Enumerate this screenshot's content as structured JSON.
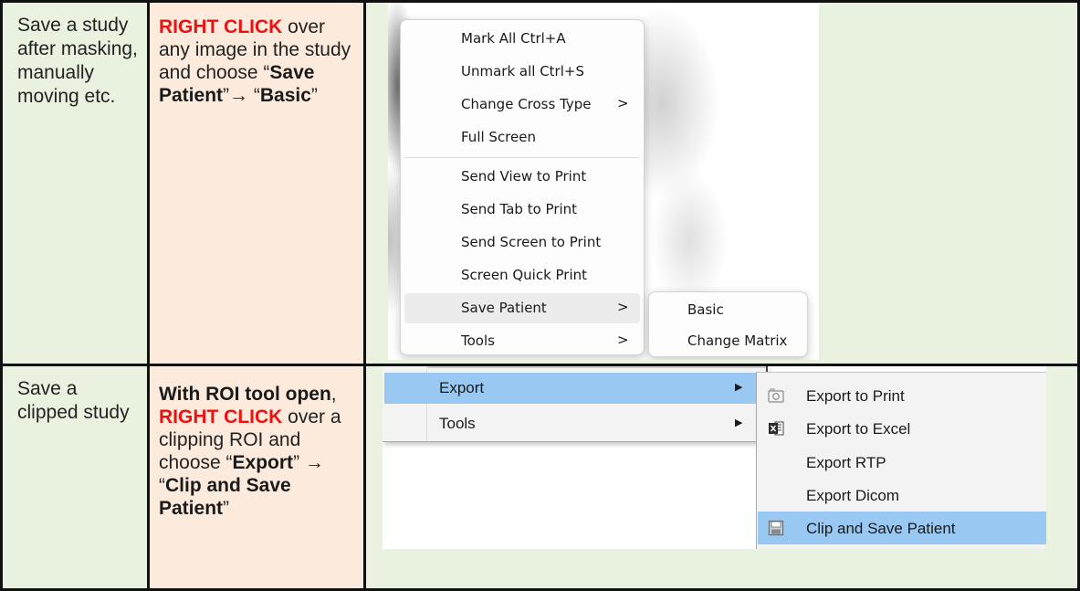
{
  "rows": [
    {
      "task": "Save a study after masking, manually moving etc.",
      "instruction": {
        "right_click": "RIGHT CLICK",
        "text_1": " over any image in the study and choose “",
        "save_patient": "Save Patient",
        "text_2": "”→ “",
        "basic": "Basic",
        "text_3": "”"
      },
      "context_menu": {
        "items": [
          {
            "label": "Mark All  Ctrl+A",
            "arrow": ""
          },
          {
            "label": "Unmark all  Ctrl+S",
            "arrow": ""
          },
          {
            "label": "Change Cross Type",
            "arrow": ">"
          },
          {
            "label": "Full Screen",
            "arrow": ""
          },
          {
            "label": "Send View to Print",
            "arrow": ""
          },
          {
            "label": "Send Tab to Print",
            "arrow": ""
          },
          {
            "label": "Send Screen to Print",
            "arrow": ""
          },
          {
            "label": "Screen Quick Print",
            "arrow": ""
          },
          {
            "label": "Save Patient",
            "arrow": ">"
          },
          {
            "label": "Tools",
            "arrow": ">"
          }
        ],
        "highlighted": "Save Patient",
        "submenu": [
          "Basic",
          "Change Matrix"
        ]
      }
    },
    {
      "task": "Save a clipped study",
      "instruction": {
        "with_roi": "With ROI tool open",
        "comma": ", ",
        "right_click": "RIGHT CLICK",
        "text_1": " over a clipping ROI and choose “",
        "export": "Export",
        "text_2": "” → “",
        "clip_save": "Clip and Save Patient",
        "text_3": "”"
      },
      "context_menu": {
        "items": [
          {
            "label": "Export",
            "arrow": "▶"
          },
          {
            "label": "Tools",
            "arrow": "▶"
          }
        ],
        "highlighted": "Export",
        "submenu": [
          {
            "label": "Export to Print",
            "icon": "camera-icon"
          },
          {
            "label": "Export to Excel",
            "icon": "excel-icon"
          },
          {
            "label": "Export RTP",
            "icon": ""
          },
          {
            "label": "Export Dicom",
            "icon": ""
          },
          {
            "label": "Clip and Save Patient",
            "icon": "floppy-disk-icon"
          }
        ],
        "submenu_highlighted": "Clip and Save Patient"
      }
    }
  ],
  "colors": {
    "task_bg": "#e9f2df",
    "instruction_bg": "#fcebdc",
    "keyword_red": "#ee1111",
    "menu_highlight_blue": "#99c8f3"
  }
}
